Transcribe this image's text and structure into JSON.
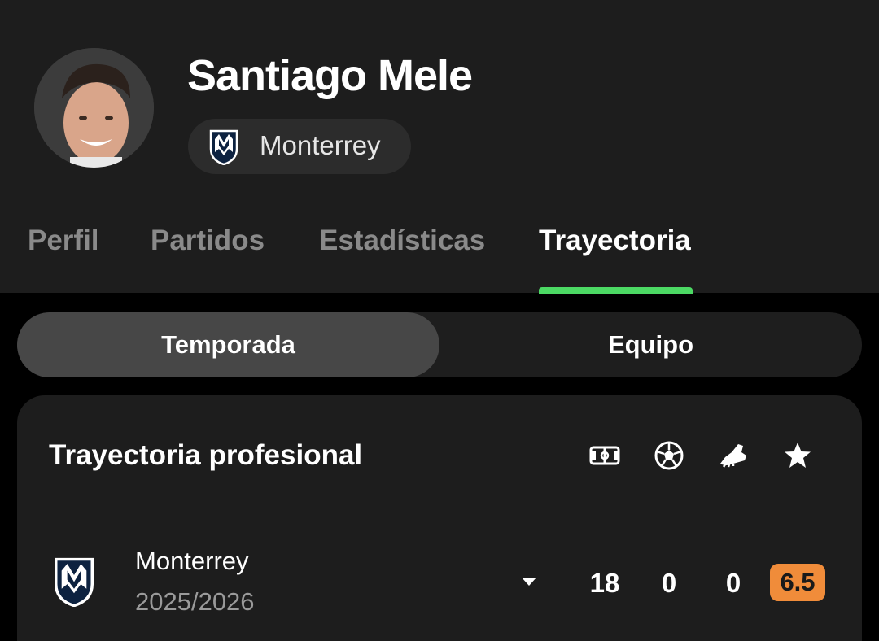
{
  "player": {
    "name": "Santiago Mele",
    "team": "Monterrey"
  },
  "tabs": [
    {
      "label": "Perfil",
      "active": false
    },
    {
      "label": "Partidos",
      "active": false
    },
    {
      "label": "Estadísticas",
      "active": false
    },
    {
      "label": "Trayectoria",
      "active": true
    }
  ],
  "segmented": {
    "options": [
      "Temporada",
      "Equipo"
    ],
    "selected": "Temporada"
  },
  "card": {
    "title": "Trayectoria profesional",
    "stat_icons": [
      "lineup-pitch-icon",
      "ball-icon",
      "boot-icon",
      "star-icon"
    ],
    "rows": [
      {
        "team": "Monterrey",
        "season": "2025/2026",
        "appearances": "18",
        "goals": "0",
        "assists": "0",
        "rating": "6.5"
      }
    ]
  },
  "colors": {
    "accent": "#4cd964",
    "rating_badge": "#f08c3a",
    "header_bg": "#1d1d1d",
    "page_bg": "#000000"
  }
}
